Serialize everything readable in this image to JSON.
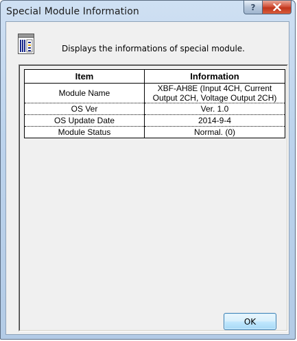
{
  "window": {
    "title": "Special Module Information",
    "help_label": "?",
    "close_label": "X"
  },
  "description": "Displays the informations of special module.",
  "table": {
    "headers": {
      "item": "Item",
      "information": "Information"
    },
    "rows": [
      {
        "item": "Module Name",
        "info_line1": "XBF-AH8E (Input 4CH, Current",
        "info_line2": "Output 2CH, Voltage Output 2CH)"
      },
      {
        "item": "OS Ver",
        "info": "Ver.  1.0"
      },
      {
        "item": "OS Update Date",
        "info": "2014-9-4"
      },
      {
        "item": "Module Status",
        "info": "Normal. (0)"
      }
    ]
  },
  "buttons": {
    "ok": "OK"
  },
  "colors": {
    "title_bar": "#bcd3ec",
    "close_button": "#c0361c",
    "ok_button": "#bee6fd"
  },
  "icons": {
    "module_icon": "module-rack-icon"
  }
}
